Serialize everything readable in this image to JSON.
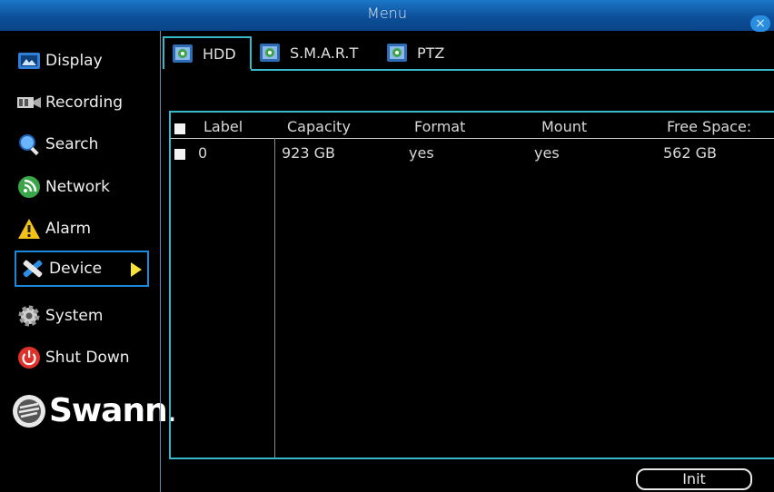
{
  "window": {
    "title": "Menu",
    "close_glyph": "×"
  },
  "sidebar": {
    "items": [
      {
        "label": "Display",
        "icon": "display-icon"
      },
      {
        "label": "Recording",
        "icon": "recording-icon"
      },
      {
        "label": "Search",
        "icon": "search-icon"
      },
      {
        "label": "Network",
        "icon": "network-icon"
      },
      {
        "label": "Alarm",
        "icon": "alarm-icon"
      },
      {
        "label": "Device",
        "icon": "device-icon",
        "active": true
      },
      {
        "label": "System",
        "icon": "system-icon"
      },
      {
        "label": "Shut Down",
        "icon": "power-icon"
      }
    ],
    "logo_text": "Swann",
    "logo_dot": "."
  },
  "tabs": [
    {
      "label": "HDD",
      "active": true
    },
    {
      "label": "S.M.A.R.T"
    },
    {
      "label": "PTZ"
    }
  ],
  "table": {
    "headers": [
      "Label",
      "Capacity",
      "Format",
      "Mount",
      "Free Space:"
    ],
    "rows": [
      {
        "label": "0",
        "capacity": "923 GB",
        "format": "yes",
        "mount": "yes",
        "free": "562 GB"
      }
    ]
  },
  "buttons": {
    "init": "Init"
  },
  "colors": {
    "accent": "#36b9c8",
    "titlebar": "#0c4f99",
    "active_border": "#1a88d8",
    "arrow": "#f5e23a"
  }
}
